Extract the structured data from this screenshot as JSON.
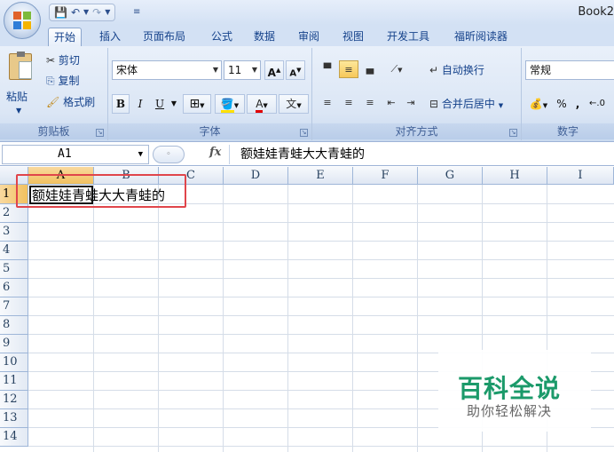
{
  "window": {
    "title": "Book2"
  },
  "tabs": [
    "开始",
    "插入",
    "页面布局",
    "公式",
    "数据",
    "审阅",
    "视图",
    "开发工具",
    "福昕阅读器"
  ],
  "clipboard": {
    "paste": "粘贴",
    "cut": "剪切",
    "copy": "复制",
    "format_painter": "格式刷",
    "label": "剪贴板"
  },
  "font": {
    "name": "宋体",
    "size": "11",
    "bold": "B",
    "italic": "I",
    "underline": "U",
    "label": "字体"
  },
  "alignment": {
    "wrap_text": "自动换行",
    "merge_center": "合并后居中",
    "label": "对齐方式"
  },
  "number": {
    "format": "常规",
    "percent": "%",
    "comma": ",",
    "label": "数字"
  },
  "formula_bar": {
    "name_box": "A1",
    "fx": "fx",
    "content": "额娃娃青蛙大大青蛙的"
  },
  "columns": [
    "A",
    "B",
    "C",
    "D",
    "E",
    "F",
    "G",
    "H",
    "I"
  ],
  "rows": [
    "1",
    "2",
    "3",
    "4",
    "5",
    "6",
    "7",
    "8",
    "9",
    "10",
    "11",
    "12",
    "13",
    "14"
  ],
  "cells": {
    "A1": "额娃娃青蛙大大青蛙的"
  },
  "selected_cell": "A1",
  "watermark": {
    "title": "百科全说",
    "subtitle": "助你轻松解决"
  },
  "colors": {
    "accent": "#15428b",
    "highlight": "#f1c15f",
    "annotation": "#e0454b",
    "watermark": "#1b9a6a"
  }
}
